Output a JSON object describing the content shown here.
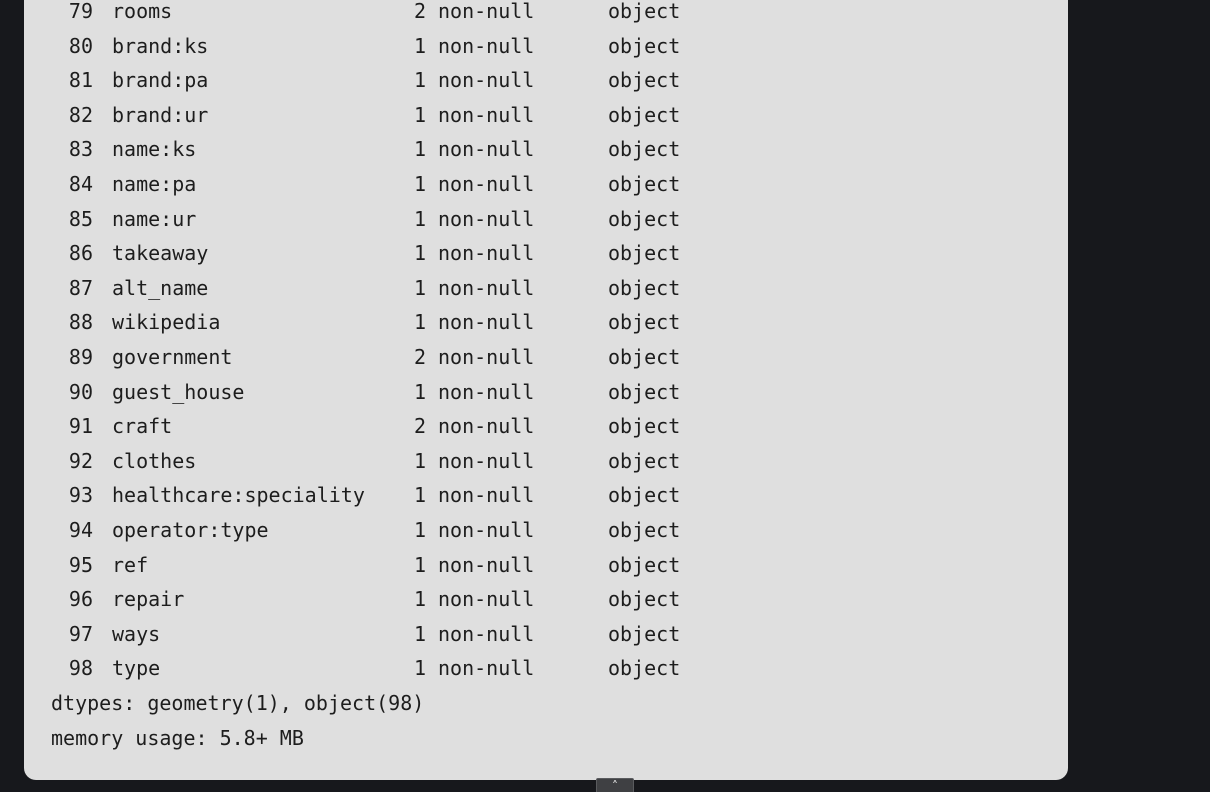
{
  "columns": [
    {
      "index": "79",
      "name": "rooms",
      "count": "2",
      "non_null": "non-null",
      "dtype": "object"
    },
    {
      "index": "80",
      "name": "brand:ks",
      "count": "1",
      "non_null": "non-null",
      "dtype": "object"
    },
    {
      "index": "81",
      "name": "brand:pa",
      "count": "1",
      "non_null": "non-null",
      "dtype": "object"
    },
    {
      "index": "82",
      "name": "brand:ur",
      "count": "1",
      "non_null": "non-null",
      "dtype": "object"
    },
    {
      "index": "83",
      "name": "name:ks",
      "count": "1",
      "non_null": "non-null",
      "dtype": "object"
    },
    {
      "index": "84",
      "name": "name:pa",
      "count": "1",
      "non_null": "non-null",
      "dtype": "object"
    },
    {
      "index": "85",
      "name": "name:ur",
      "count": "1",
      "non_null": "non-null",
      "dtype": "object"
    },
    {
      "index": "86",
      "name": "takeaway",
      "count": "1",
      "non_null": "non-null",
      "dtype": "object"
    },
    {
      "index": "87",
      "name": "alt_name",
      "count": "1",
      "non_null": "non-null",
      "dtype": "object"
    },
    {
      "index": "88",
      "name": "wikipedia",
      "count": "1",
      "non_null": "non-null",
      "dtype": "object"
    },
    {
      "index": "89",
      "name": "government",
      "count": "2",
      "non_null": "non-null",
      "dtype": "object"
    },
    {
      "index": "90",
      "name": "guest_house",
      "count": "1",
      "non_null": "non-null",
      "dtype": "object"
    },
    {
      "index": "91",
      "name": "craft",
      "count": "2",
      "non_null": "non-null",
      "dtype": "object"
    },
    {
      "index": "92",
      "name": "clothes",
      "count": "1",
      "non_null": "non-null",
      "dtype": "object"
    },
    {
      "index": "93",
      "name": "healthcare:speciality",
      "count": "1",
      "non_null": "non-null",
      "dtype": "object"
    },
    {
      "index": "94",
      "name": "operator:type",
      "count": "1",
      "non_null": "non-null",
      "dtype": "object"
    },
    {
      "index": "95",
      "name": "ref",
      "count": "1",
      "non_null": "non-null",
      "dtype": "object"
    },
    {
      "index": "96",
      "name": "repair",
      "count": "1",
      "non_null": "non-null",
      "dtype": "object"
    },
    {
      "index": "97",
      "name": "ways",
      "count": "1",
      "non_null": "non-null",
      "dtype": "object"
    },
    {
      "index": "98",
      "name": "type",
      "count": "1",
      "non_null": "non-null",
      "dtype": "object"
    }
  ],
  "summary": {
    "dtypes": "dtypes: geometry(1), object(98)",
    "memory": "memory usage: 5.8+ MB"
  },
  "scroll_button": {
    "icon": "chevron-up-icon",
    "glyph": "˄"
  },
  "colors": {
    "page_background": "#17181c",
    "panel_background": "#dfdfdf",
    "text": "#1d1d1d"
  }
}
